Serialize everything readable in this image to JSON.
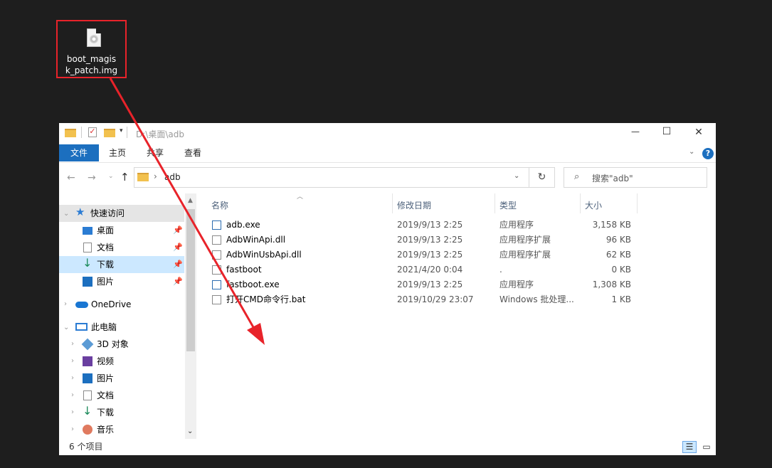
{
  "desktop_icon": {
    "label_line1": "boot_magis",
    "label_line2": "k_patch.img"
  },
  "window": {
    "title_path": "D:\\桌面\\adb",
    "ribbon_tabs": [
      "文件",
      "主页",
      "共享",
      "查看"
    ],
    "address": {
      "crumb_sep": "›",
      "folder": "adb"
    },
    "search_placeholder": "搜索\"adb\"",
    "caption": {
      "minimize": "—",
      "maximize": "☐",
      "close": "✕"
    }
  },
  "sidebar": {
    "quick_access": "快速访问",
    "quick_items": [
      "桌面",
      "文档",
      "下载",
      "图片"
    ],
    "onedrive": "OneDrive",
    "this_pc": "此电脑",
    "pc_items": [
      "3D 对象",
      "视频",
      "图片",
      "文档",
      "下载",
      "音乐"
    ]
  },
  "columns": {
    "name": "名称",
    "date": "修改日期",
    "type": "类型",
    "size": "大小"
  },
  "files": [
    {
      "name": "adb.exe",
      "date": "2019/9/13 2:25",
      "type": "应用程序",
      "size": "3,158 KB",
      "icon": "exe-icon"
    },
    {
      "name": "AdbWinApi.dll",
      "date": "2019/9/13 2:25",
      "type": "应用程序扩展",
      "size": "96 KB",
      "icon": "dll-icon"
    },
    {
      "name": "AdbWinUsbApi.dll",
      "date": "2019/9/13 2:25",
      "type": "应用程序扩展",
      "size": "62 KB",
      "icon": "dll-icon"
    },
    {
      "name": "fastboot",
      "date": "2021/4/20 0:04",
      "type": ".",
      "size": "0 KB",
      "icon": "blank-file-icon"
    },
    {
      "name": "fastboot.exe",
      "date": "2019/9/13 2:25",
      "type": "应用程序",
      "size": "1,308 KB",
      "icon": "exe-icon"
    },
    {
      "name": "打开CMD命令行.bat",
      "date": "2019/10/29 23:07",
      "type": "Windows 批处理...",
      "size": "1 KB",
      "icon": "bat-icon"
    }
  ],
  "status": {
    "count": "6 个项目"
  },
  "colors": {
    "accent": "#1c6fbf",
    "highlight_box": "#e8232a",
    "arrow": "#e8232a",
    "desktop_bg": "#1e1e1e"
  }
}
